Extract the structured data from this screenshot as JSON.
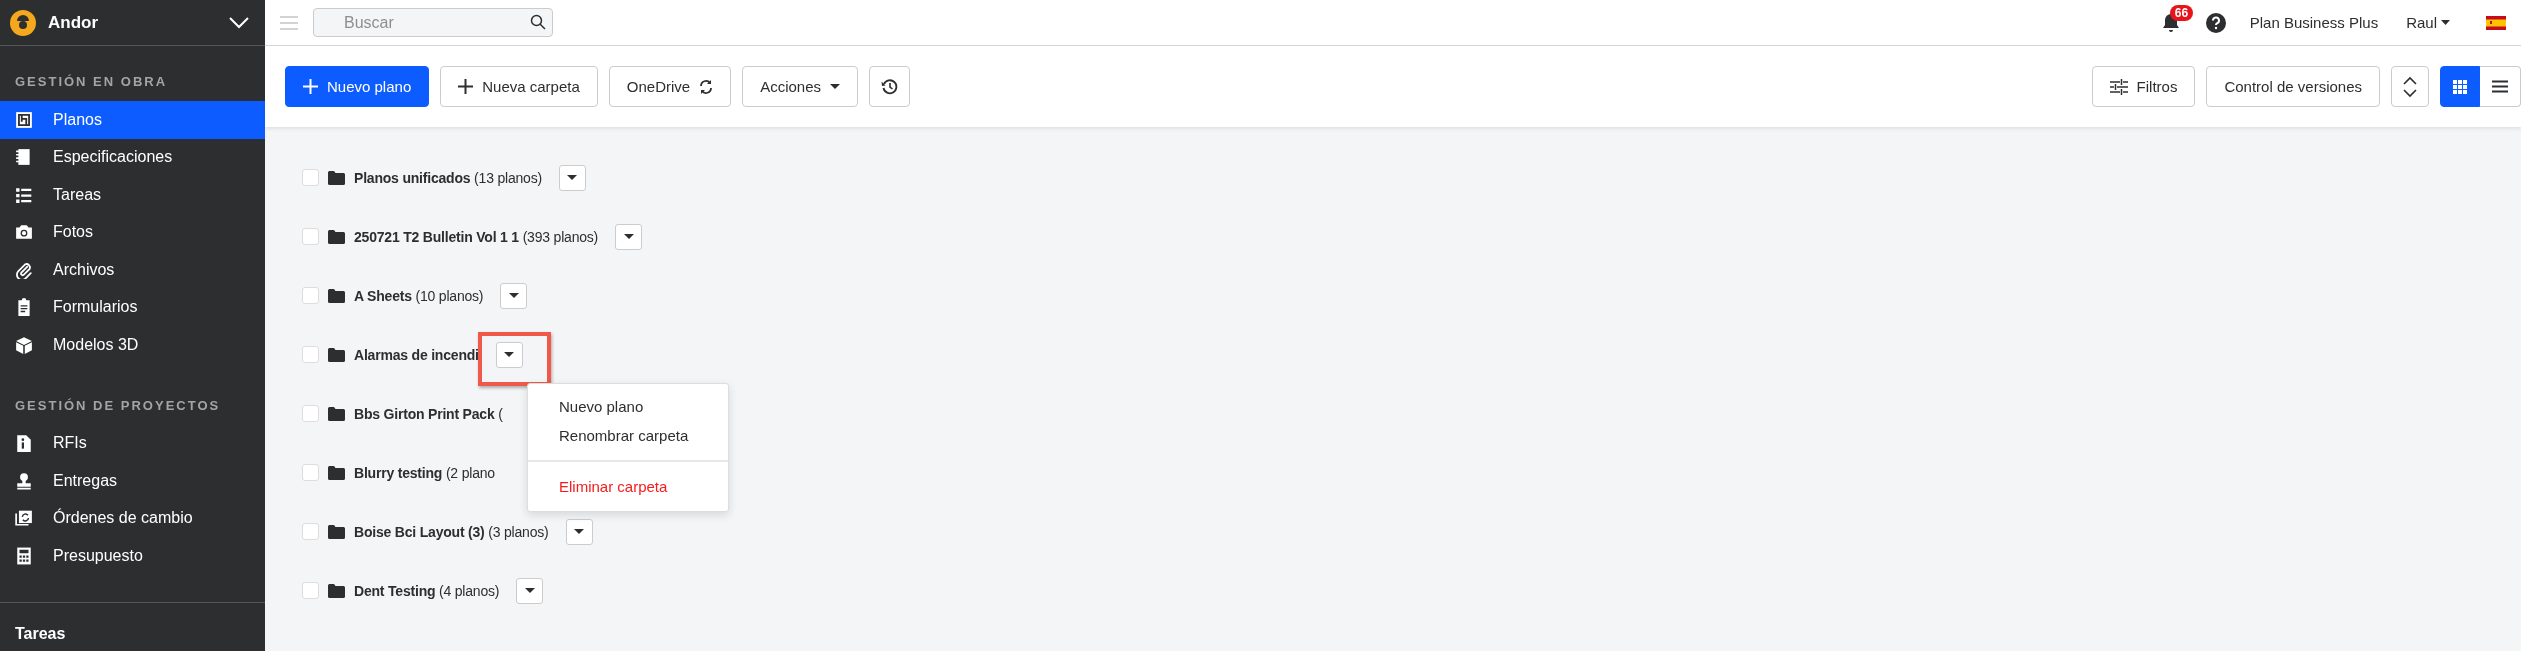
{
  "sidebar": {
    "project": "Andor",
    "sections": [
      {
        "title": "GESTIÓN EN OBRA",
        "items": [
          {
            "label": "Planos",
            "selected": true
          },
          {
            "label": "Especificaciones",
            "selected": false
          },
          {
            "label": "Tareas",
            "selected": false
          },
          {
            "label": "Fotos",
            "selected": false
          },
          {
            "label": "Archivos",
            "selected": false
          },
          {
            "label": "Formularios",
            "selected": false
          },
          {
            "label": "Modelos 3D",
            "selected": false
          }
        ]
      },
      {
        "title": "GESTIÓN DE PROYECTOS",
        "items": [
          {
            "label": "RFIs",
            "selected": false
          },
          {
            "label": "Entregas",
            "selected": false
          },
          {
            "label": "Órdenes de cambio",
            "selected": false
          },
          {
            "label": "Presupuesto",
            "selected": false
          }
        ]
      }
    ],
    "footer_heading": "Tareas"
  },
  "topbar": {
    "search": {
      "placeholder": "Buscar"
    },
    "notifications": "66",
    "plan": "Plan Business Plus",
    "user": "Raul"
  },
  "toolbar": {
    "left": [
      {
        "label": "Nuevo plano",
        "kind": "primary"
      },
      {
        "label": "Nueva carpeta",
        "kind": "plus"
      },
      {
        "label": "OneDrive",
        "kind": "sync"
      },
      {
        "label": "Acciones",
        "kind": "dropdown"
      },
      {
        "kind": "history"
      }
    ],
    "right": [
      {
        "label": "Filtros",
        "kind": "filter"
      },
      {
        "label": "Control de versiones",
        "kind": "plain"
      },
      {
        "kind": "sort"
      }
    ],
    "view_toggle": [
      {
        "kind": "grid",
        "selected": true
      },
      {
        "kind": "list",
        "selected": false
      }
    ]
  },
  "folders": [
    {
      "label": "**Planos unificados** (13 planos)",
      "checked": false,
      "menu_button": true
    },
    {
      "label": "**250721 T2 Bulletin Vol 1 1** (393 planos)",
      "checked": false,
      "menu_button": true
    },
    {
      "label": "**A Sheets** (10 planos)",
      "checked": false,
      "menu_button": true
    },
    {
      "label": "**Alarmas de incendi**",
      "checked": false,
      "menu_button": true,
      "highlighted": true
    },
    {
      "label": "**Bbs Girton Print Pack** (",
      "checked": false,
      "menu_button": false
    },
    {
      "label": "**Blurry testing** (2 plano",
      "checked": false,
      "menu_button": false
    },
    {
      "label": "**Boise Bci Layout (3)** (3 planos)",
      "checked": false,
      "menu_button": true
    },
    {
      "label": "**Dent Testing** (4 planos)",
      "checked": false,
      "menu_button": true
    }
  ],
  "context_menu": {
    "items": [
      {
        "label": "Nuevo plano",
        "kind": "normal"
      },
      {
        "label": "Renombrar carpeta",
        "kind": "normal"
      },
      {
        "label": "Eliminar carpeta",
        "kind": "danger"
      }
    ]
  }
}
